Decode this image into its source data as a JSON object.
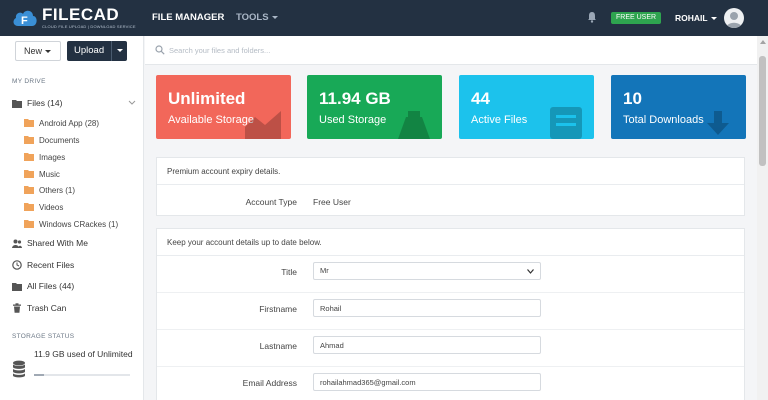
{
  "header": {
    "logo_title": "FILECAD",
    "logo_subtitle": "CLOUD FILE UPLOAD | DOWNLOAD SERVICE",
    "nav": {
      "file_manager": "FILE MANAGER",
      "tools": "TOOLS"
    },
    "badge": "FREE USER",
    "user_name": "ROHAIL"
  },
  "sidebar": {
    "new_label": "New",
    "upload_label": "Upload",
    "my_drive_label": "MY DRIVE",
    "files_label": "Files (14)",
    "folders": [
      {
        "label": "Android App (28)"
      },
      {
        "label": "Documents"
      },
      {
        "label": "Images"
      },
      {
        "label": "Music"
      },
      {
        "label": "Others (1)"
      },
      {
        "label": "Videos"
      },
      {
        "label": "Windows CRackes (1)"
      }
    ],
    "shared_label": "Shared With Me",
    "recent_label": "Recent Files",
    "all_files_label": "All Files (44)",
    "trash_label": "Trash Can",
    "storage_status_label": "STORAGE STATUS",
    "storage_text": "11.9 GB used of Unlimited"
  },
  "search": {
    "placeholder": "Search your files and folders..."
  },
  "stats": [
    {
      "value": "Unlimited",
      "label": "Available Storage",
      "color": "#f2675a"
    },
    {
      "value": "11.94 GB",
      "label": "Used Storage",
      "color": "#18a957"
    },
    {
      "value": "44",
      "label": "Active Files",
      "color": "#1cc2ec"
    },
    {
      "value": "10",
      "label": "Total Downloads",
      "color": "#1375b9"
    }
  ],
  "expiry_panel": {
    "heading": "Premium account expiry details.",
    "account_type_label": "Account Type",
    "account_type_value": "Free User"
  },
  "details_panel": {
    "heading": "Keep your account details up to date below.",
    "title_label": "Title",
    "title_value": "Mr",
    "firstname_label": "Firstname",
    "firstname_value": "Rohail",
    "lastname_label": "Lastname",
    "lastname_value": "Ahmad",
    "email_label": "Email Address",
    "email_value": "rohailahmad365@gmail.com"
  },
  "colors": {
    "nav_bg": "#233142",
    "badge": "#2ea44f",
    "folder": "#f0a35a"
  }
}
